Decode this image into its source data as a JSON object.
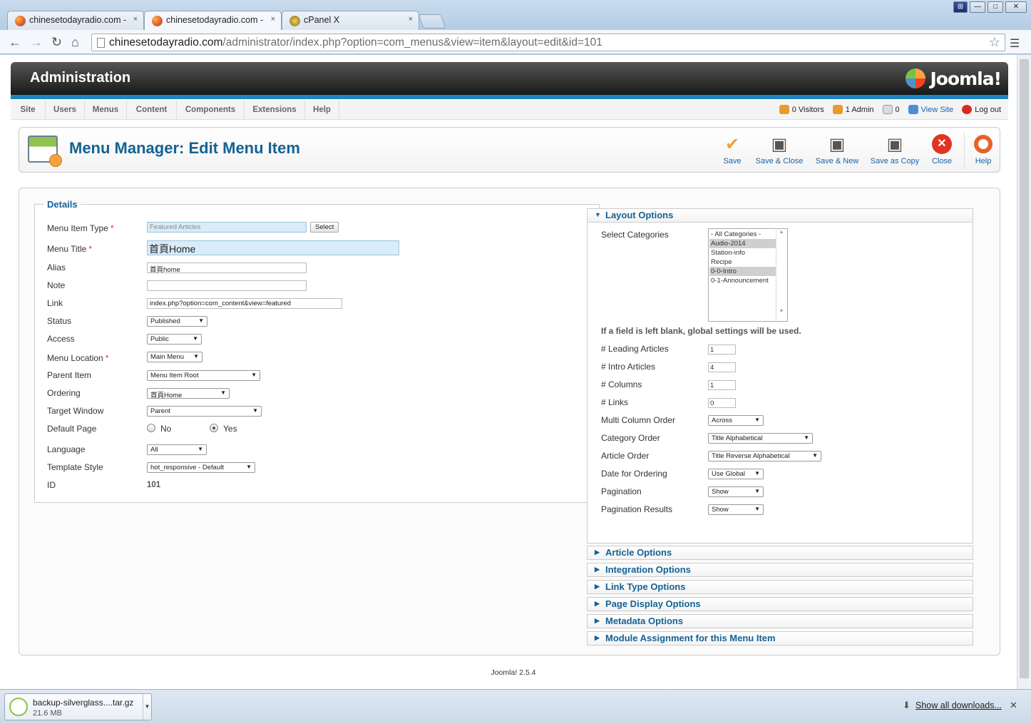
{
  "browser": {
    "tabs": [
      {
        "label": "chinesetodayradio.com - ",
        "active": false
      },
      {
        "label": "chinesetodayradio.com - ",
        "active": true
      },
      {
        "label": "cPanel X",
        "active": false
      }
    ],
    "tab_close": "×",
    "url_host": "chinesetodayradio.com",
    "url_path": "/administrator/index.php?option=com_menus&view=item&layout=edit&id=101",
    "window_buttons": [
      "⊞",
      "—",
      "□",
      "✕"
    ]
  },
  "header": {
    "title": "Administration",
    "logo_text": "Joomla!"
  },
  "menubar": {
    "items": [
      "Site",
      "Users",
      "Menus",
      "Content",
      "Components",
      "Extensions",
      "Help"
    ],
    "visitors": "0 Visitors",
    "admins": "1 Admin",
    "messages": "0",
    "view_site": "View Site",
    "logout": "Log out"
  },
  "toolbar": {
    "title": "Menu Manager: Edit Menu Item",
    "buttons": [
      {
        "label": "Save",
        "icon": "check-icon"
      },
      {
        "label": "Save & Close",
        "icon": "floppy-icon"
      },
      {
        "label": "Save & New",
        "icon": "floppy-new-icon"
      },
      {
        "label": "Save as Copy",
        "icon": "floppy-copy-icon"
      },
      {
        "label": "Close",
        "icon": "close-circle-icon"
      },
      {
        "label": "Help",
        "icon": "lifebuoy-icon"
      }
    ]
  },
  "details": {
    "legend": "Details",
    "menu_item_type_label": "Menu Item Type",
    "menu_item_type_value": "Featured Articles",
    "select_label": "Select",
    "menu_title_label": "Menu Title",
    "menu_title_value": "首頁Home",
    "alias_label": "Alias",
    "alias_value": "首頁home",
    "note_label": "Note",
    "note_value": "",
    "link_label": "Link",
    "link_value": "index.php?option=com_content&view=featured",
    "status_label": "Status",
    "status_value": "Published",
    "access_label": "Access",
    "access_value": "Public",
    "menu_location_label": "Menu Location",
    "menu_location_value": "Main Menu",
    "parent_item_label": "Parent Item",
    "parent_item_value": "Menu Item Root",
    "ordering_label": "Ordering",
    "ordering_value": "首頁Home",
    "target_window_label": "Target Window",
    "target_window_value": "Parent",
    "default_page_label": "Default Page",
    "default_no": "No",
    "default_yes": "Yes",
    "language_label": "Language",
    "language_value": "All",
    "template_style_label": "Template Style",
    "template_style_value": "hot_responsive - Default",
    "id_label": "ID",
    "id_value": "101",
    "required_mark": "*"
  },
  "layout_options": {
    "title": "Layout Options",
    "select_categories_label": "Select Categories",
    "categories": [
      {
        "name": "- All Categories -",
        "selected": false
      },
      {
        "name": "Audio-2014",
        "selected": true
      },
      {
        "name": "Station-info",
        "selected": false
      },
      {
        "name": "Recipe",
        "selected": false
      },
      {
        "name": "0-0-Intro",
        "selected": true
      },
      {
        "name": "0-1-Announcement",
        "selected": false
      }
    ],
    "note": "If a field is left blank, global settings will be used.",
    "leading_label": "# Leading Articles",
    "leading_value": "1",
    "intro_label": "# Intro Articles",
    "intro_value": "4",
    "columns_label": "# Columns",
    "columns_value": "1",
    "links_label": "# Links",
    "links_value": "0",
    "multi_col_label": "Multi Column Order",
    "multi_col_value": "Across",
    "cat_order_label": "Category Order",
    "cat_order_value": "Title Alphabetical",
    "art_order_label": "Article Order",
    "art_order_value": "Title Reverse Alphabetical",
    "date_label": "Date for Ordering",
    "date_value": "Use Global",
    "pagination_label": "Pagination",
    "pagination_value": "Show",
    "pag_results_label": "Pagination Results",
    "pag_results_value": "Show"
  },
  "panels": [
    "Article Options",
    "Integration Options",
    "Link Type Options",
    "Page Display Options",
    "Metadata Options",
    "Module Assignment for this Menu Item"
  ],
  "footer": {
    "version": "Joomla! 2.5.4"
  },
  "downloads": {
    "file_name": "backup-silverglass....tar.gz",
    "file_size": "21.6 MB",
    "show_all": "Show all downloads..."
  }
}
